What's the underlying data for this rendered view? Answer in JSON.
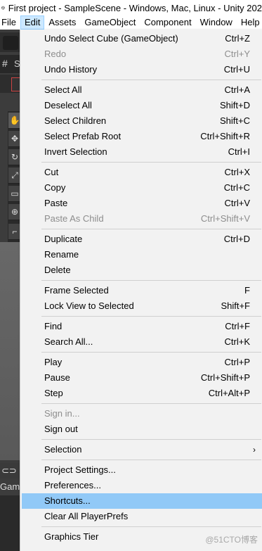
{
  "window": {
    "title": "First project - SampleScene - Windows, Mac, Linux - Unity 202"
  },
  "menubar": {
    "items": [
      "File",
      "Edit",
      "Assets",
      "GameObject",
      "Component",
      "Window",
      "Help"
    ],
    "active": "Edit"
  },
  "background": {
    "tab_hash": "#",
    "tab_s": "S",
    "game_tab_icon": "gamepad-icon",
    "game_label": "Gam"
  },
  "edit_menu": {
    "items": [
      {
        "label": "Undo Select Cube (GameObject)",
        "shortcut": "Ctrl+Z",
        "enabled": true
      },
      {
        "label": "Redo",
        "shortcut": "Ctrl+Y",
        "enabled": false
      },
      {
        "label": "Undo History",
        "shortcut": "Ctrl+U",
        "enabled": true
      },
      {
        "label": "Select All",
        "shortcut": "Ctrl+A",
        "enabled": true
      },
      {
        "label": "Deselect All",
        "shortcut": "Shift+D",
        "enabled": true
      },
      {
        "label": "Select Children",
        "shortcut": "Shift+C",
        "enabled": true
      },
      {
        "label": "Select Prefab Root",
        "shortcut": "Ctrl+Shift+R",
        "enabled": true
      },
      {
        "label": "Invert Selection",
        "shortcut": "Ctrl+I",
        "enabled": true
      },
      {
        "label": "Cut",
        "shortcut": "Ctrl+X",
        "enabled": true
      },
      {
        "label": "Copy",
        "shortcut": "Ctrl+C",
        "enabled": true
      },
      {
        "label": "Paste",
        "shortcut": "Ctrl+V",
        "enabled": true
      },
      {
        "label": "Paste As Child",
        "shortcut": "Ctrl+Shift+V",
        "enabled": false
      },
      {
        "label": "Duplicate",
        "shortcut": "Ctrl+D",
        "enabled": true
      },
      {
        "label": "Rename",
        "shortcut": "",
        "enabled": true
      },
      {
        "label": "Delete",
        "shortcut": "",
        "enabled": true
      },
      {
        "label": "Frame Selected",
        "shortcut": "F",
        "enabled": true
      },
      {
        "label": "Lock View to Selected",
        "shortcut": "Shift+F",
        "enabled": true
      },
      {
        "label": "Find",
        "shortcut": "Ctrl+F",
        "enabled": true
      },
      {
        "label": "Search All...",
        "shortcut": "Ctrl+K",
        "enabled": true
      },
      {
        "label": "Play",
        "shortcut": "Ctrl+P",
        "enabled": true
      },
      {
        "label": "Pause",
        "shortcut": "Ctrl+Shift+P",
        "enabled": true
      },
      {
        "label": "Step",
        "shortcut": "Ctrl+Alt+P",
        "enabled": true
      },
      {
        "label": "Sign in...",
        "shortcut": "",
        "enabled": false
      },
      {
        "label": "Sign out",
        "shortcut": "",
        "enabled": true
      },
      {
        "label": "Selection",
        "shortcut": "",
        "enabled": true,
        "submenu": true
      },
      {
        "label": "Project Settings...",
        "shortcut": "",
        "enabled": true
      },
      {
        "label": "Preferences...",
        "shortcut": "",
        "enabled": true
      },
      {
        "label": "Shortcuts...",
        "shortcut": "",
        "enabled": true,
        "highlighted": true
      },
      {
        "label": "Clear All PlayerPrefs",
        "shortcut": "",
        "enabled": true
      },
      {
        "label": "Graphics Tier",
        "shortcut": "",
        "enabled": true,
        "submenu": true
      }
    ]
  },
  "watermark": "@51CTO博客"
}
